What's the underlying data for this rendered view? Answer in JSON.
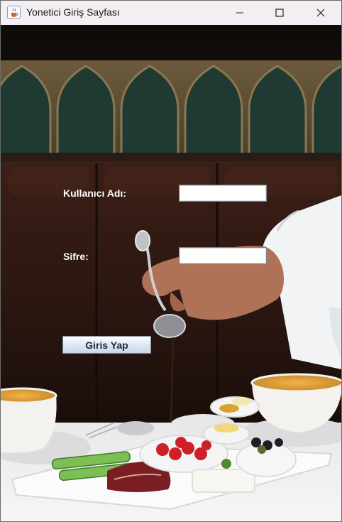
{
  "window": {
    "title": "Yonetici Giriş Sayfası",
    "icon": "java-cup-icon"
  },
  "form": {
    "username_label": "Kullanıcı Adı:",
    "username_value": "",
    "password_label": "Sifre:",
    "password_value": "",
    "login_button": "Giris Yap"
  },
  "colors": {
    "titlebar": "#f3eef1",
    "label_text": "#ffffff",
    "button_gradient_top": "#ffffff",
    "button_gradient_bottom": "#c9d8ea"
  }
}
